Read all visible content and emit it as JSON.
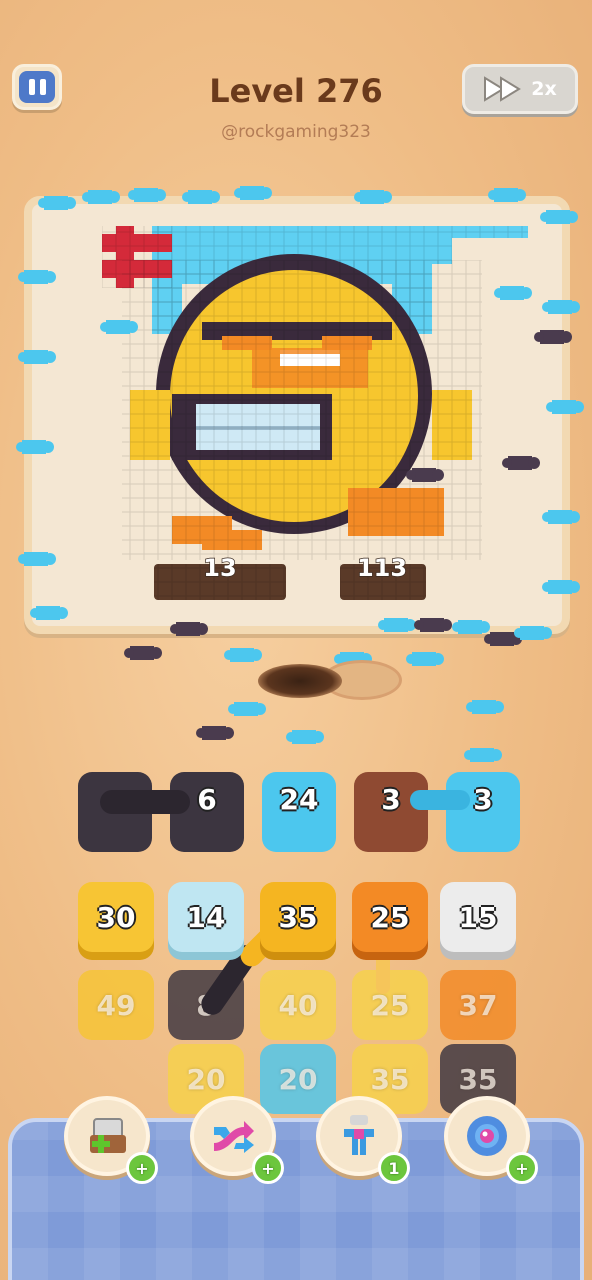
{
  "header": {
    "title": "Level 276",
    "handle": "@rockgaming323",
    "speed_label": "2x"
  },
  "board": {
    "picture": "pixel-art yellow face",
    "counters": [
      "13",
      "113"
    ]
  },
  "slots": [
    {
      "value": "6",
      "color": "#3c3540"
    },
    {
      "value": "24",
      "color": "#4cc7ee"
    },
    {
      "value": "3",
      "color": "#8f4a32"
    },
    {
      "value": "3",
      "color": "#4cc7ee"
    }
  ],
  "grid": {
    "row1": [
      {
        "value": "30",
        "color": "#f7c534"
      },
      {
        "value": "14",
        "color": "#bfe6f2"
      },
      {
        "value": "35",
        "color": "#f5b521"
      },
      {
        "value": "25",
        "color": "#f38a25"
      },
      {
        "value": "15",
        "color": "#ececec"
      }
    ],
    "row2": [
      {
        "value": "49",
        "color": "#f7c534"
      },
      {
        "value": "8",
        "color": "#3c3540"
      },
      {
        "value": "40",
        "color": "#f7d24a"
      },
      {
        "value": "25",
        "color": "#f7d24a"
      },
      {
        "value": "37",
        "color": "#f38a25"
      }
    ],
    "row3": [
      {
        "value": "20",
        "color": "#f7d24a"
      },
      {
        "value": "20",
        "color": "#4cc7ee"
      },
      {
        "value": "35",
        "color": "#f7d24a"
      },
      {
        "value": "35",
        "color": "#3c3540"
      }
    ]
  },
  "boosters": [
    {
      "icon": "add-box-icon",
      "badge": "+"
    },
    {
      "icon": "shuffle-arrows-icon",
      "badge": "+"
    },
    {
      "icon": "magnet-claw-icon",
      "badge": "1"
    },
    {
      "icon": "donut-gear-icon",
      "badge": "+"
    }
  ],
  "colors": {
    "ant_blue": "#4cc7ee",
    "ant_dark": "#4a3b4e",
    "tray": "#7f9bd8"
  }
}
